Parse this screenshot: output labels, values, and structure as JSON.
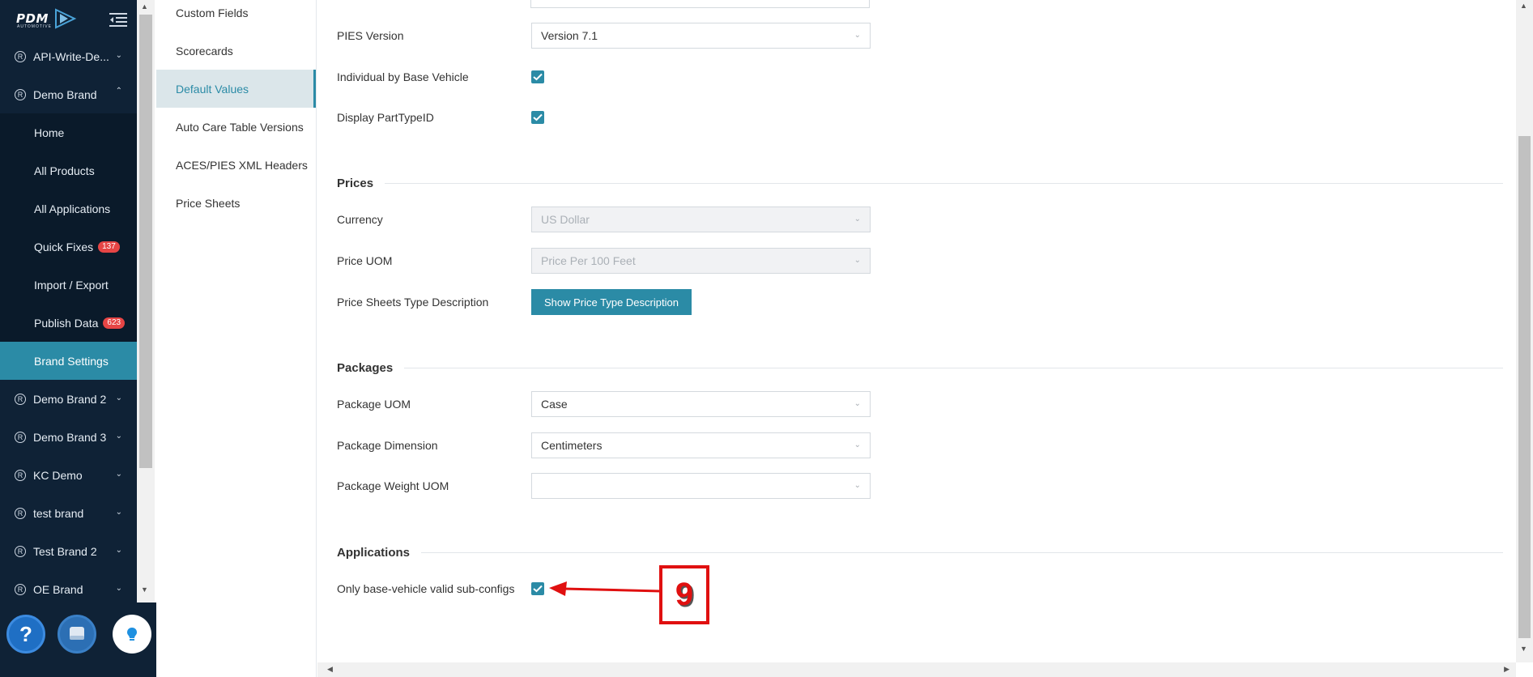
{
  "sidebar": {
    "logo": "PDM",
    "logo_sub": "AUTOMOTIVE",
    "brands_top": [
      {
        "label": "API-Write-De..."
      },
      {
        "label": "Demo Brand"
      }
    ],
    "subnav": [
      {
        "label": "Home"
      },
      {
        "label": "All Products"
      },
      {
        "label": "All Applications"
      },
      {
        "label": "Quick Fixes",
        "badge": "137"
      },
      {
        "label": "Import / Export"
      },
      {
        "label": "Publish Data",
        "badge": "623"
      },
      {
        "label": "Brand Settings",
        "active": true
      }
    ],
    "brands_bottom": [
      {
        "label": "Demo Brand 2"
      },
      {
        "label": "Demo Brand 3"
      },
      {
        "label": "KC Demo"
      },
      {
        "label": "test brand"
      },
      {
        "label": "Test Brand 2"
      },
      {
        "label": "OE Brand"
      }
    ],
    "reg_symbol": "R"
  },
  "settings_nav": {
    "items": [
      {
        "label": "Custom Fields"
      },
      {
        "label": "Scorecards"
      },
      {
        "label": "Default Values",
        "active": true
      },
      {
        "label": "Auto Care Table Versions"
      },
      {
        "label": "ACES/PIES XML Headers"
      },
      {
        "label": "Price Sheets"
      }
    ]
  },
  "main": {
    "pies_version": {
      "label": "PIES Version",
      "value": "Version 7.1"
    },
    "individual_by_base_vehicle": {
      "label": "Individual by Base Vehicle",
      "checked": true
    },
    "display_parttypeid": {
      "label": "Display PartTypeID",
      "checked": true
    },
    "prices": {
      "title": "Prices",
      "currency": {
        "label": "Currency",
        "value": "US Dollar"
      },
      "price_uom": {
        "label": "Price UOM",
        "value": "Price Per 100 Feet"
      },
      "price_sheets_type": {
        "label": "Price Sheets Type Description",
        "button": "Show Price Type Description"
      }
    },
    "packages": {
      "title": "Packages",
      "package_uom": {
        "label": "Package UOM",
        "value": "Case"
      },
      "package_dimension": {
        "label": "Package Dimension",
        "value": "Centimeters"
      },
      "package_weight_uom": {
        "label": "Package Weight UOM",
        "value": ""
      }
    },
    "applications": {
      "title": "Applications",
      "only_base_vehicle": {
        "label": "Only base-vehicle valid sub-configs",
        "checked": true
      }
    }
  },
  "annotation": {
    "number": "9"
  },
  "colors": {
    "accent": "#2b8ba6",
    "sidebar_bg": "#0f2236",
    "badge": "#e64545",
    "annotation": "#e01010"
  },
  "icons": [
    "collapse-menu-icon",
    "registered-icon",
    "chevron-down-icon",
    "chevron-up-icon",
    "checkbox-checked-icon",
    "help-icon",
    "chat-icon",
    "lightbulb-icon"
  ]
}
